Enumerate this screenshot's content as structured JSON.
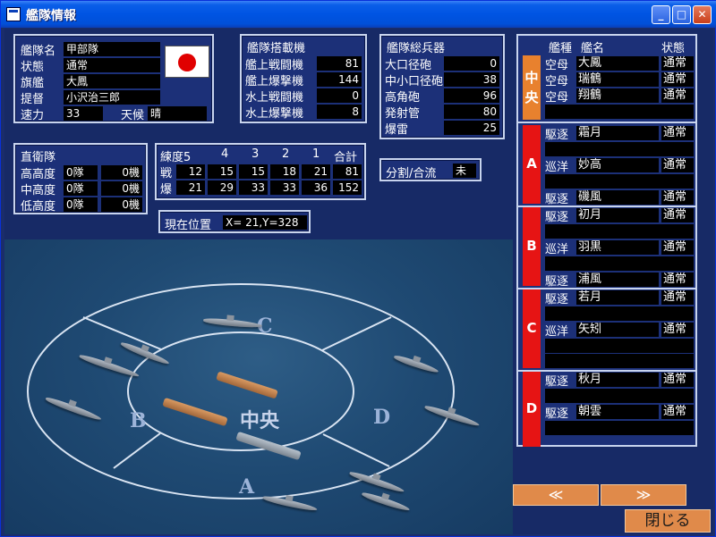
{
  "window": {
    "title": "艦隊情報"
  },
  "fleet": {
    "name_label": "艦隊名",
    "name": "甲部隊",
    "state_label": "状態",
    "state": "通常",
    "flagship_label": "旗艦",
    "flagship": "大鳳",
    "admiral_label": "提督",
    "admiral": "小沢治三郎",
    "speed_label": "速力",
    "speed": "33",
    "weather_label": "天候",
    "weather": "晴"
  },
  "aircraft": {
    "title": "艦隊搭載機",
    "rows": [
      {
        "label": "艦上戦闘機",
        "value": "81"
      },
      {
        "label": "艦上爆撃機",
        "value": "144"
      },
      {
        "label": "水上戦闘機",
        "value": "0"
      },
      {
        "label": "水上爆撃機",
        "value": "8"
      }
    ]
  },
  "weapons": {
    "title": "艦隊総兵器",
    "rows": [
      {
        "label": "大口径砲",
        "value": "0"
      },
      {
        "label": "中小口径砲",
        "value": "38"
      },
      {
        "label": "高角砲",
        "value": "96"
      },
      {
        "label": "発射管",
        "value": "80"
      },
      {
        "label": "爆雷",
        "value": "25"
      }
    ]
  },
  "escort": {
    "title": "直衛隊",
    "rows": [
      {
        "label": "高高度",
        "units": "0隊",
        "planes": "0機"
      },
      {
        "label": "中高度",
        "units": "0隊",
        "planes": "0機"
      },
      {
        "label": "低高度",
        "units": "0隊",
        "planes": "0機"
      }
    ]
  },
  "training": {
    "header": [
      "練度5",
      "4",
      "3",
      "2",
      "1",
      "合計"
    ],
    "rows": [
      {
        "label": "戦",
        "values": [
          "12",
          "15",
          "15",
          "18",
          "21",
          "81"
        ]
      },
      {
        "label": "爆",
        "values": [
          "21",
          "29",
          "33",
          "33",
          "36",
          "152"
        ]
      }
    ]
  },
  "split": {
    "label": "分割/合流",
    "value": "未"
  },
  "position": {
    "label": "現在位置",
    "value": "X= 21,Y=328"
  },
  "map": {
    "sectors": {
      "center": "中央",
      "a": "A",
      "b": "B",
      "c": "C",
      "d": "D"
    }
  },
  "roster": {
    "headers": {
      "type": "艦種",
      "name": "艦名",
      "status": "状態"
    },
    "groups": [
      {
        "label": "中央",
        "color": "#e8812e",
        "ships": [
          {
            "type": "空母",
            "name": "大鳳",
            "status": "通常"
          },
          {
            "type": "空母",
            "name": "瑞鶴",
            "status": "通常"
          },
          {
            "type": "空母",
            "name": "翔鶴",
            "status": "通常"
          }
        ]
      },
      {
        "label": "A",
        "color": "#e61414",
        "ships": [
          {
            "type": "駆逐",
            "name": "霜月",
            "status": "通常"
          },
          {
            "type": "巡洋",
            "name": "妙高",
            "status": "通常"
          },
          {
            "type": "駆逐",
            "name": "磯風",
            "status": "通常"
          }
        ]
      },
      {
        "label": "B",
        "color": "#e61414",
        "ships": [
          {
            "type": "駆逐",
            "name": "初月",
            "status": "通常"
          },
          {
            "type": "巡洋",
            "name": "羽黒",
            "status": "通常"
          },
          {
            "type": "駆逐",
            "name": "浦風",
            "status": "通常"
          }
        ]
      },
      {
        "label": "C",
        "color": "#e61414",
        "ships": [
          {
            "type": "駆逐",
            "name": "若月",
            "status": "通常"
          },
          {
            "type": "巡洋",
            "name": "矢矧",
            "status": "通常"
          }
        ]
      },
      {
        "label": "D",
        "color": "#e61414",
        "ships": [
          {
            "type": "駆逐",
            "name": "秋月",
            "status": "通常"
          },
          {
            "type": "駆逐",
            "name": "朝雲",
            "status": "通常"
          }
        ]
      }
    ]
  },
  "buttons": {
    "prev": "≪",
    "next": "≫",
    "close": "閉じる"
  }
}
